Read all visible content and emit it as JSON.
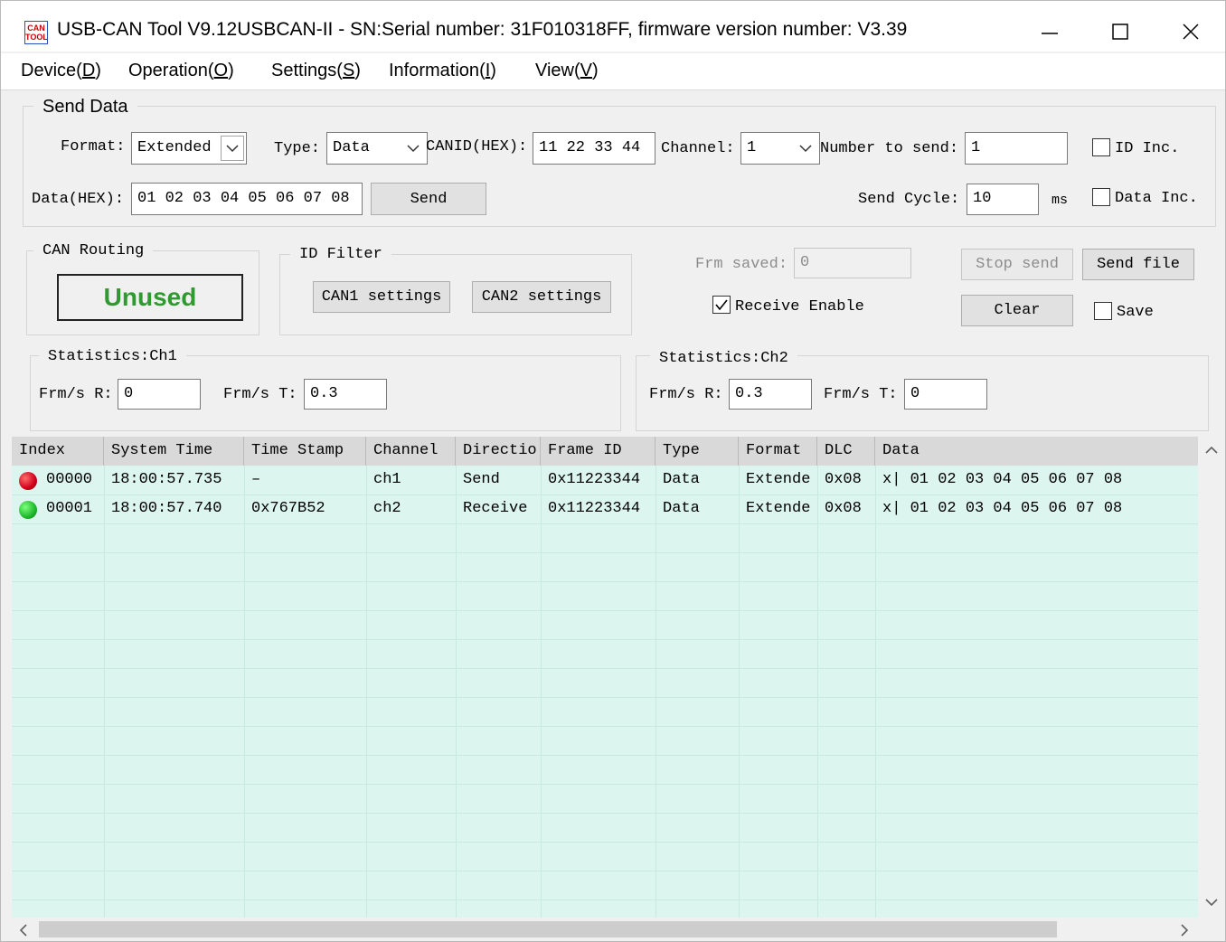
{
  "window": {
    "icon_text": "CAN TOOL",
    "title": "USB-CAN Tool V9.12USBCAN-II - SN:Serial number: 31F010318FF, firmware version number: V3.39"
  },
  "menu": [
    {
      "label": "Device",
      "mnemonic": "D"
    },
    {
      "label": "Operation",
      "mnemonic": "O"
    },
    {
      "label": "Settings",
      "mnemonic": "S"
    },
    {
      "label": "Information",
      "mnemonic": "I"
    },
    {
      "label": "View",
      "mnemonic": "V"
    }
  ],
  "send_data": {
    "group_title": "Send Data",
    "format_label": "Format:",
    "format_value": "Extended",
    "type_label": "Type:",
    "type_value": "Data",
    "canid_label": "CANID(HEX):",
    "canid_value": "11 22 33 44",
    "channel_label": "Channel:",
    "channel_value": "1",
    "number_label": "Number to send:",
    "number_value": "1",
    "id_inc_label": "ID Inc.",
    "id_inc_checked": false,
    "data_label": "Data(HEX):",
    "data_value": "01 02 03 04 05 06 07 08",
    "send_button": "Send",
    "cycle_label": "Send Cycle:",
    "cycle_value": "10",
    "cycle_unit": "ms",
    "data_inc_label": "Data Inc.",
    "data_inc_checked": false
  },
  "can_routing": {
    "group_title": "CAN Routing",
    "button": "Unused"
  },
  "id_filter": {
    "group_title": "ID Filter",
    "can1_button": "CAN1 settings",
    "can2_button": "CAN2 settings"
  },
  "receive": {
    "frm_saved_label": "Frm saved:",
    "frm_saved_value": "0",
    "receive_enable_label": "Receive Enable",
    "receive_enable_checked": true,
    "stop_send_button": "Stop send",
    "send_file_button": "Send file",
    "clear_button": "Clear",
    "save_label": "Save",
    "save_checked": false
  },
  "stats_ch1": {
    "group_title": "Statistics:Ch1",
    "r_label": "Frm/s R:",
    "r_value": "0",
    "t_label": "Frm/s T:",
    "t_value": "0.3"
  },
  "stats_ch2": {
    "group_title": "Statistics:Ch2",
    "r_label": "Frm/s R:",
    "r_value": "0.3",
    "t_label": "Frm/s T:",
    "t_value": "0"
  },
  "table": {
    "columns": [
      "Index",
      "System Time",
      "Time Stamp",
      "Channel",
      "Directio",
      "Frame ID",
      "Type",
      "Format",
      "DLC",
      "Data"
    ],
    "rows": [
      {
        "status": "red",
        "index": "00000",
        "system_time": "18:00:57.735",
        "time_stamp": "–",
        "channel": "ch1",
        "direction": "Send",
        "frame_id": "0x11223344",
        "type": "Data",
        "format": "Extende",
        "dlc": "0x08",
        "data": "x| 01 02 03 04 05 06 07 08"
      },
      {
        "status": "green",
        "index": "00001",
        "system_time": "18:00:57.740",
        "time_stamp": "0x767B52",
        "channel": "ch2",
        "direction": "Receive",
        "frame_id": "0x11223344",
        "type": "Data",
        "format": "Extende",
        "dlc": "0x08",
        "data": "x| 01 02 03 04 05 06 07 08"
      }
    ]
  },
  "colors": {
    "grid_bg": "#dcf5ee",
    "unused_text": "#2f9a2f",
    "status_red": "#d0021b",
    "status_green": "#1fb82b"
  }
}
